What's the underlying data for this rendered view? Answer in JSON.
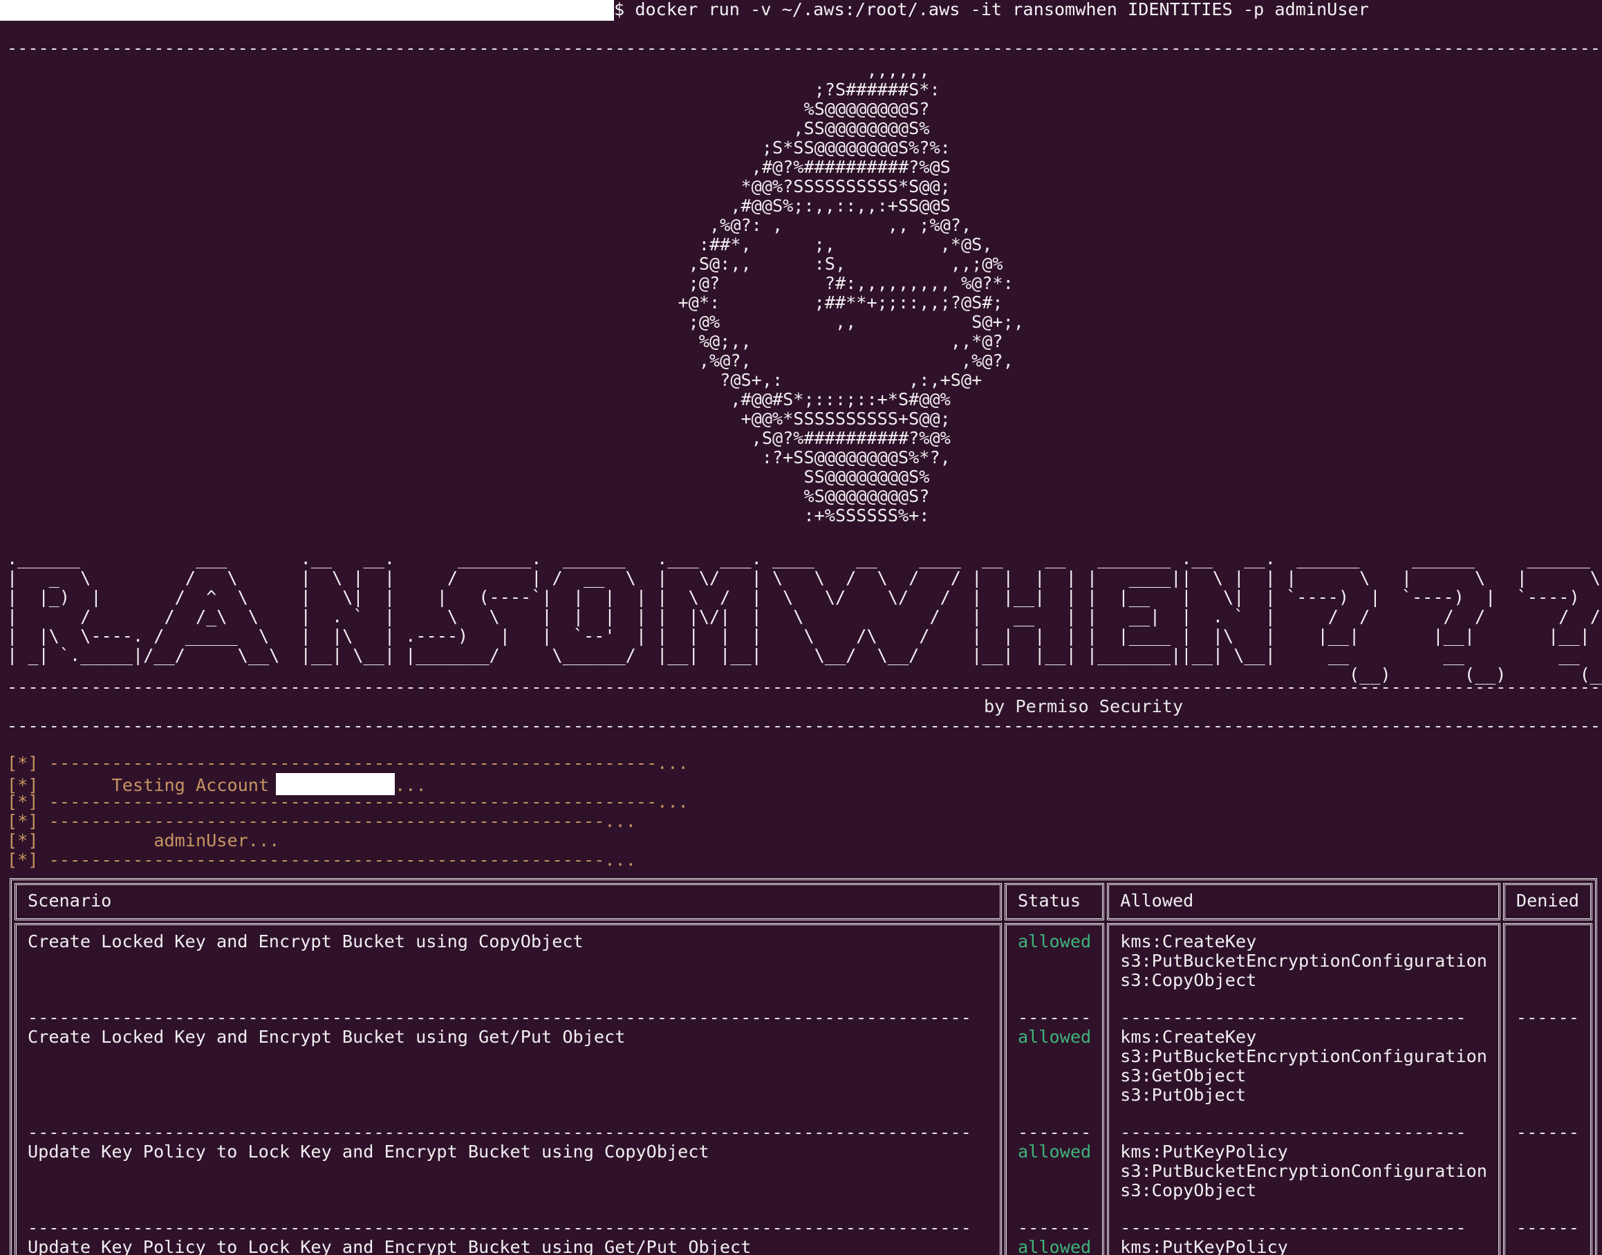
{
  "command": "$ docker run -v ~/.aws:/root/.aws -it ransomwhen IDENTITIES -p adminUser",
  "rule_long": "-------------------------------------------------------------------------------------------------------------------------------------------------------------------------------------------------------------------------",
  "ascii_art": "                                                                                  ,,,,,,\n                                                                             ;?S######S*:\n                                                                            %S@@@@@@@@S?\n                                                                           ,SS@@@@@@@@S%\n                                                                        ;S*SS@@@@@@@@S%?%:\n                                                                       ,#@?%##########?%@S\n                                                                      *@@%?SSSSSSSSSS*S@@;\n                                                                     ,#@@S%;:,,::,,:+SS@@S\n                                                                   ,%@?: ,          ,, ;%@?,\n                                                                  :##*,      ;,          ,*@S,\n                                                                 ,S@:,,      :S,          ,,;@%\n                                                                 ;@?          ?#:,,,,,,,,, %@?*:\n                                                                +@*:         ;##**+;;::,,;?@S#;\n                                                                 ;@%           ,,           S@+;,\n                                                                  %@;,,                   ,,*@?\n                                                                  ,%@?,                    ,%@?,\n                                                                    ?@S+,:            ,:,+S@+\n                                                                     ,#@@#S*;:::;::+*S#@@%\n                                                                      +@@%*SSSSSSSSSS+S@@;\n                                                                       ,S@?%##########?%@%\n                                                                        :?+SS@@@@@@@@S%*?,\n                                                                            SS@@@@@@@@S%\n                                                                            %S@@@@@@@@S?\n                                                                            :+%SSSSSS%+:",
  "banner": ".______           ___       .__   __.      _______.  ______   .___  ___. ____    __    ____  __    __   _______ .__   __.  ______     ______     ______\n|   _  \\         /   \\      |  \\ |  |     /       | /  __  \\  |   \\/   | \\   \\  /  \\  /   / |  |  |  | |   ____||  \\ |  | |      \\   |      \\   |      \\\n|  |_)  |       /  ^  \\     |   \\|  |    |   (----`|  |  |  | |  \\  /  |  \\   \\/    \\/   /  |  |__|  | |  |__   |   \\|  | `----)  |  `----)  |  `----)  |\n|      /       /  /_\\  \\    |  . `  |     \\   \\    |  |  |  | |  |\\/|  |   \\            /   |   __   | |   __|  |  . `  |     /  /       /  /       /  /\n|  |\\  \\----. /  _____  \\   |  |\\   | .----)   |   |  `--'  | |  |  |  |    \\    /\\    /    |  |  |  | |  |____ |  |\\   |    |__|       |__|       |__|\n| _| `._____|/__/     \\__\\  |__| \\__| |_______/     \\______/  |__|  |__|     \\__/  \\__/     |__|  |__| |_______||__| \\__|     __         __         __\n                                                                                                                                (__)       (__)       (__)",
  "credit": "by Permiso Security",
  "log": {
    "prefix": "[*]",
    "rule_a": "----------------------------------------------------------...",
    "testing_label": "      Testing Account",
    "testing_suffix": "...",
    "rule_b": "-----------------------------------------------------...",
    "user_line": "          adminUser..."
  },
  "table": {
    "headers": [
      "Scenario",
      "Status",
      "Allowed",
      "Denied"
    ],
    "separators": {
      "scenario": "------------------------------------------------------------------------------------------",
      "status": "-------",
      "allowed": "---------------------------------",
      "denied": "------"
    },
    "rows": [
      {
        "scenario": "Create Locked Key and Encrypt Bucket using CopyObject",
        "status": "allowed",
        "allowed": "kms:CreateKey\ns3:PutBucketEncryptionConfiguration\ns3:CopyObject",
        "denied": ""
      },
      {
        "scenario": "Create Locked Key and Encrypt Bucket using Get/Put Object",
        "status": "allowed",
        "allowed": "kms:CreateKey\ns3:PutBucketEncryptionConfiguration\ns3:GetObject\ns3:PutObject",
        "denied": ""
      },
      {
        "scenario": "Update Key Policy to Lock Key and Encrypt Bucket using CopyObject",
        "status": "allowed",
        "allowed": "kms:PutKeyPolicy\ns3:PutBucketEncryptionConfiguration\ns3:CopyObject",
        "denied": ""
      },
      {
        "scenario": "Update Key Policy to Lock Key and Encrypt Bucket using Get/Put Object",
        "status": "allowed",
        "allowed": "kms:PutKeyPolicy",
        "denied": ""
      }
    ]
  },
  "colors": {
    "background": "#2f122a",
    "text": "#eae7e8",
    "log": "#c79461",
    "allowed": "#3fb37a"
  }
}
